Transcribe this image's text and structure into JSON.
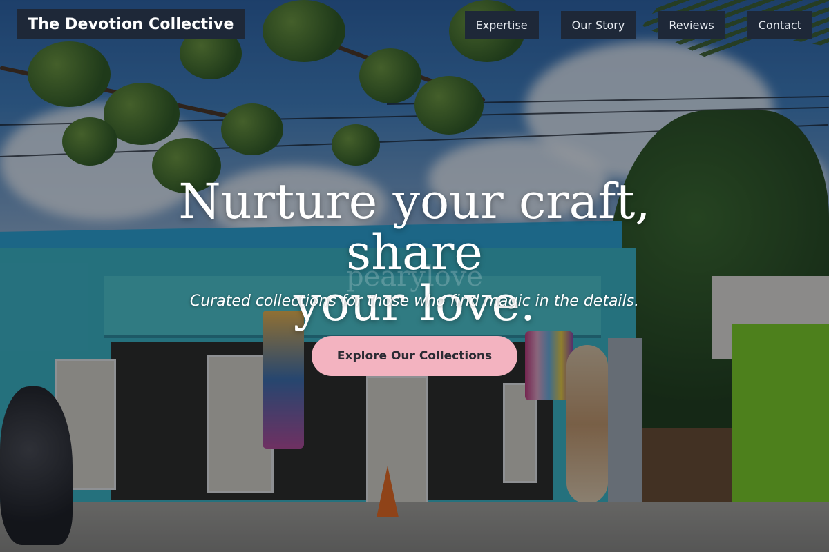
{
  "header": {
    "brand": "The Devotion Collective",
    "nav": [
      {
        "label": "Expertise"
      },
      {
        "label": "Our Story"
      },
      {
        "label": "Reviews"
      },
      {
        "label": "Contact"
      }
    ]
  },
  "hero": {
    "headline_line1": "Nurture your craft, share",
    "headline_line2": "your love.",
    "ghost_text": "pearylove",
    "subtitle": "Curated collections for those who find magic in the details.",
    "cta_label": "Explore Our Collections"
  },
  "colors": {
    "header_bg": "#1e2838",
    "cta_bg": "#f3b3c0",
    "text": "#ffffff"
  }
}
